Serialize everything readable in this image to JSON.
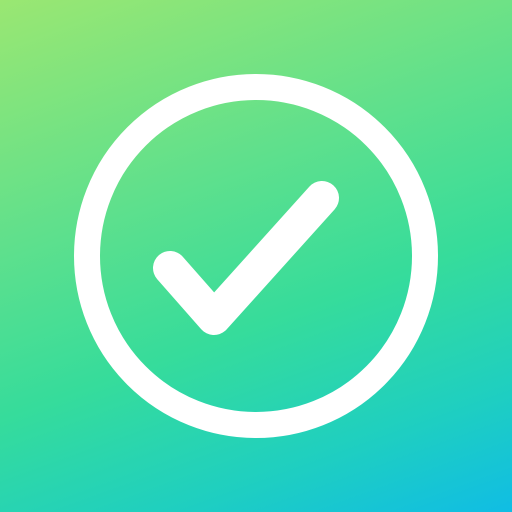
{
  "icon": {
    "name": "checkmark-circle-icon",
    "foreground_color": "#ffffff",
    "background_gradient": [
      "#9ae772",
      "#36dc9b",
      "#10bde4"
    ]
  }
}
